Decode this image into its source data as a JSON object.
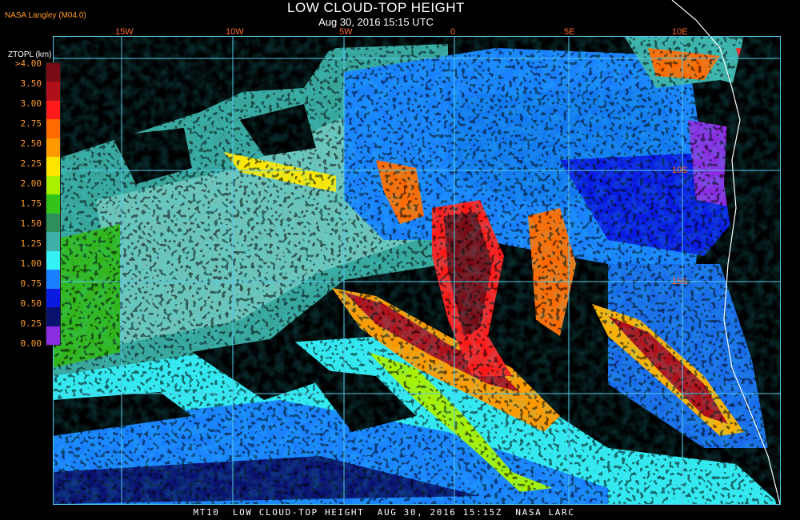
{
  "title": "LOW CLOUD-TOP HEIGHT",
  "subtitle": "Aug 30, 2016 15:15 UTC",
  "provider": "NASA Langley (M04.0)",
  "colorbar": {
    "title": "ZTOPL (km)",
    "labels": [
      ">4.00",
      "3.50",
      "3.00",
      "2.75",
      "2.50",
      "2.25",
      "2.00",
      "1.75",
      "1.50",
      "1.25",
      "1.00",
      "0.75",
      "0.50",
      "0.25",
      "0.00"
    ],
    "colors": [
      "#7a0a14",
      "#b0101a",
      "#ff1a1a",
      "#ff6a00",
      "#ff9a00",
      "#ffe600",
      "#a8f000",
      "#33c41a",
      "#2c8f5c",
      "#3fb0a8",
      "#35f0f5",
      "#1a80ff",
      "#0a1ae0",
      "#0a1270",
      "#8a2ce0"
    ]
  },
  "map": {
    "lon_labels": [
      "15W",
      "10W",
      "5W",
      "0",
      "5E",
      "10E"
    ],
    "lat_labels": [
      "10S",
      "15S"
    ],
    "colors": {
      "grid": "#55c8e8",
      "coastline": "#ffffff",
      "labels": "#ff6a2a"
    }
  },
  "footer": "MT10  LOW CLOUD-TOP HEIGHT  AUG 30, 2016 15:15Z  NASA LARC"
}
